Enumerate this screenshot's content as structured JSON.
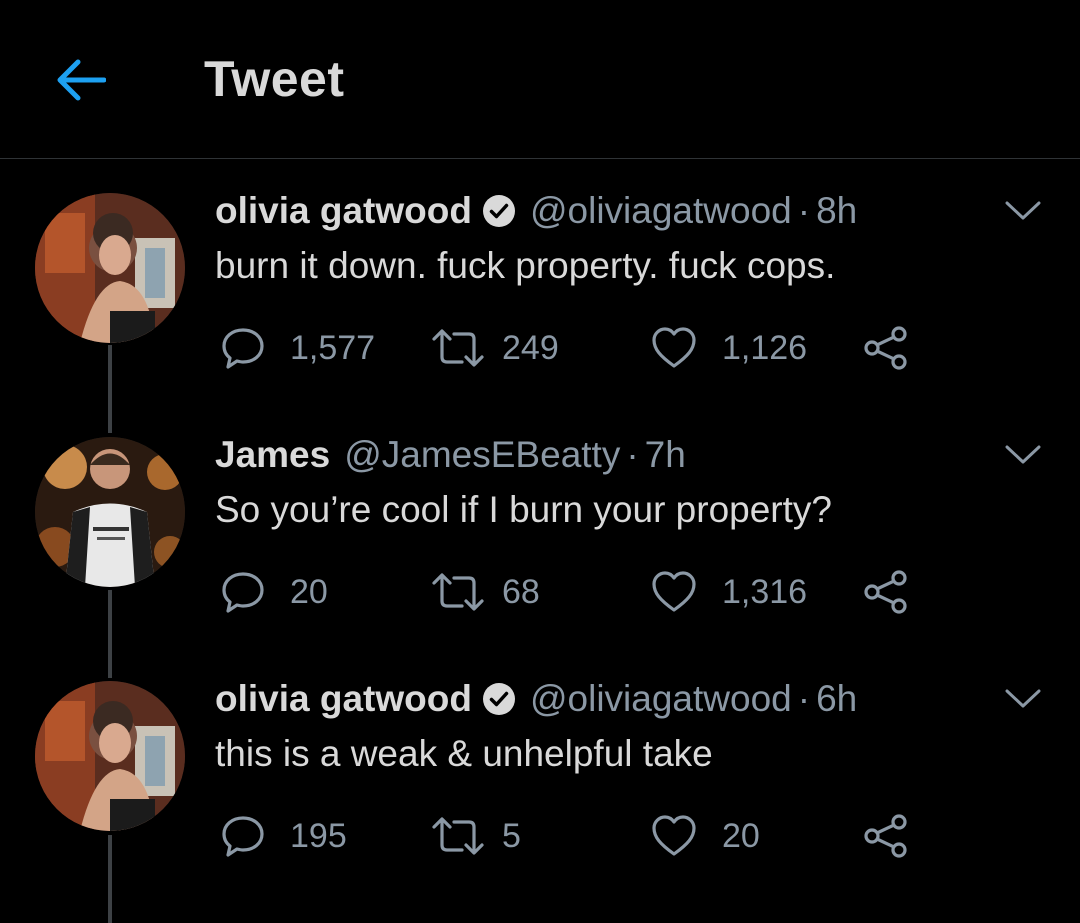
{
  "header": {
    "title": "Tweet",
    "back_icon": "arrow-left-icon",
    "accent_color": "#1da1f2"
  },
  "tweets": [
    {
      "name": "olivia gatwood",
      "verified": true,
      "handle": "@oliviagatwood",
      "separator": "·",
      "time": "8h",
      "text": "burn it down. fuck property. fuck cops.",
      "replies": "1,577",
      "retweets": "249",
      "likes": "1,126"
    },
    {
      "name": "James",
      "verified": false,
      "handle": "@JamesEBeatty",
      "separator": "·",
      "time": "7h",
      "text": "So you’re cool if I burn your property?",
      "replies": "20",
      "retweets": "68",
      "likes": "1,316"
    },
    {
      "name": "olivia gatwood",
      "verified": true,
      "handle": "@oliviagatwood",
      "separator": "·",
      "time": "6h",
      "text": "this is a weak & unhelpful take",
      "replies": "195",
      "retweets": "5",
      "likes": "20"
    }
  ]
}
